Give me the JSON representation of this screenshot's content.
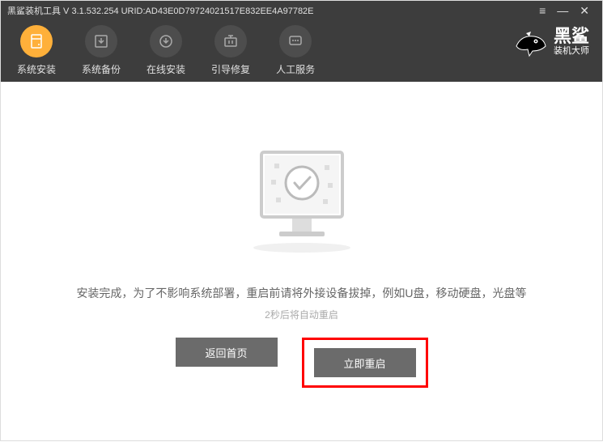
{
  "titlebar": {
    "title": "黑鲨装机工具 V 3.1.532.254 URID:AD43E0D79724021517E832EE4A97782E"
  },
  "window_controls": {
    "menu": "≡",
    "minimize": "—",
    "close": "✕"
  },
  "nav": {
    "items": [
      {
        "label": "系统安装",
        "icon": "install-icon"
      },
      {
        "label": "系统备份",
        "icon": "backup-icon"
      },
      {
        "label": "在线安装",
        "icon": "online-install-icon"
      },
      {
        "label": "引导修复",
        "icon": "boot-repair-icon"
      },
      {
        "label": "人工服务",
        "icon": "support-icon"
      }
    ]
  },
  "brand": {
    "main": "黑鲨",
    "sub": "装机大师"
  },
  "content": {
    "message_main": "安装完成，为了不影响系统部署，重启前请将外接设备拔掉，例如U盘，移动硬盘，光盘等",
    "message_sub": "2秒后将自动重启",
    "button_back": "返回首页",
    "button_restart": "立即重启"
  }
}
